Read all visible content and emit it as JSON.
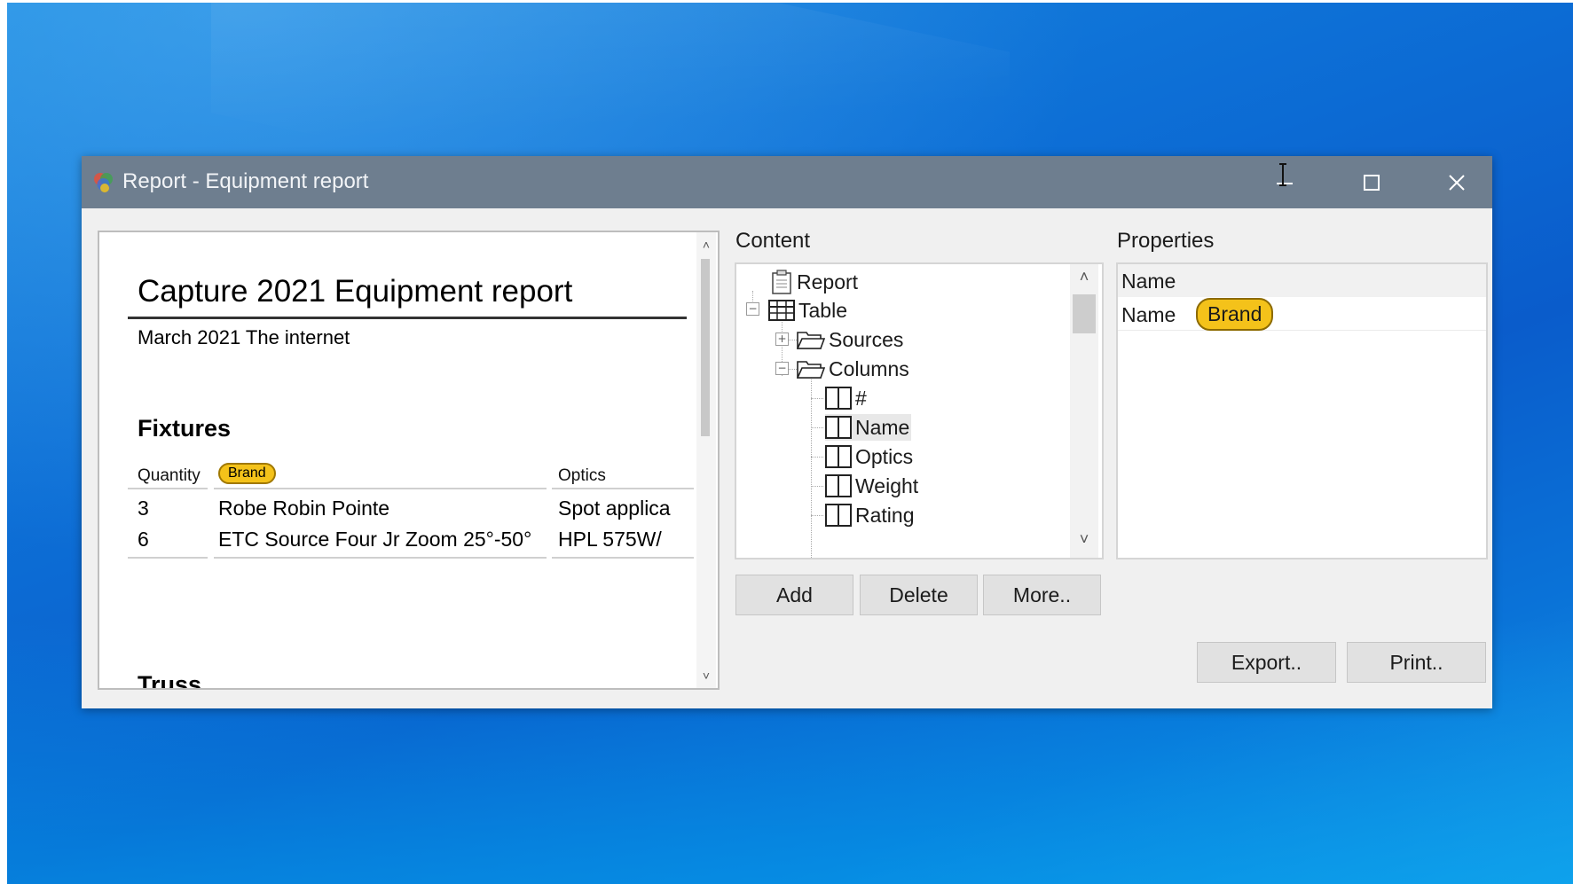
{
  "window": {
    "title": "Report - Equipment report",
    "minimize_glyph": "—",
    "maximize_glyph": "☐",
    "close_glyph": "✕",
    "accent_titlebar": "#6e7e8f"
  },
  "preview": {
    "report_title": "Capture 2021 Equipment report",
    "subtitle": "March 2021 The internet",
    "section_heading": "Fixtures",
    "columns": [
      "Quantity",
      "Brand",
      "Optics"
    ],
    "rows": [
      {
        "quantity": "3",
        "name": "Robe Robin Pointe",
        "optics": "Spot applica"
      },
      {
        "quantity": "6",
        "name": "ETC Source Four Jr Zoom 25°-50°",
        "optics": "HPL 575W/"
      }
    ],
    "next_section_partial": "Truss",
    "brand_pill_color": "#f4c21a"
  },
  "content": {
    "label": "Content",
    "tree": {
      "report": "Report",
      "table": "Table",
      "sources": "Sources",
      "columns": "Columns",
      "column_items": [
        "#",
        "Name",
        "Optics",
        "Weight",
        "Rating"
      ]
    },
    "buttons": {
      "add": "Add",
      "delete": "Delete",
      "more": "More.."
    }
  },
  "properties": {
    "label": "Properties",
    "header": "Name",
    "row_name": "Name",
    "row_value": "Brand"
  },
  "footer_buttons": {
    "export": "Export..",
    "print": "Print.."
  },
  "icons": [
    "app-icon",
    "report-icon",
    "table-icon",
    "folder-icon",
    "column-icon",
    "i-beam-cursor-icon"
  ]
}
